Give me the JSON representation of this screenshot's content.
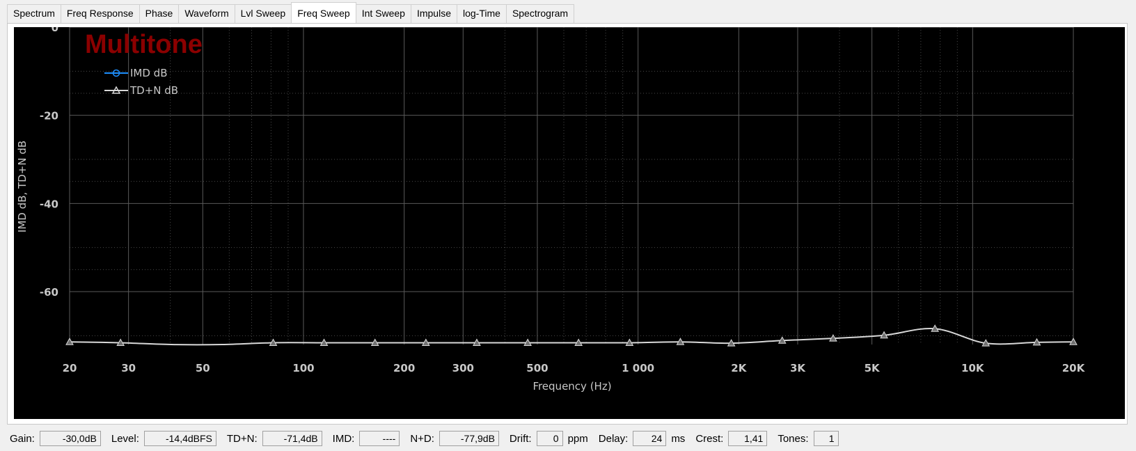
{
  "tabs": [
    {
      "label": "Spectrum",
      "active": false
    },
    {
      "label": "Freq Response",
      "active": false
    },
    {
      "label": "Phase",
      "active": false
    },
    {
      "label": "Waveform",
      "active": false
    },
    {
      "label": "Lvl Sweep",
      "active": false
    },
    {
      "label": "Freq Sweep",
      "active": true
    },
    {
      "label": "Int Sweep",
      "active": false
    },
    {
      "label": "Impulse",
      "active": false
    },
    {
      "label": "log-Time",
      "active": false
    },
    {
      "label": "Spectrogram",
      "active": false
    }
  ],
  "chart_data": {
    "type": "line",
    "watermark": "Multitone",
    "xlabel": "Frequency (Hz)",
    "ylabel": "IMD dB, TD+N dB",
    "xscale": "log",
    "xlim": [
      20,
      20000
    ],
    "ylim": [
      -72,
      0
    ],
    "x_ticks": [
      {
        "value": 20,
        "label": "20"
      },
      {
        "value": 30,
        "label": "30"
      },
      {
        "value": 50,
        "label": "50"
      },
      {
        "value": 100,
        "label": "100"
      },
      {
        "value": 200,
        "label": "200"
      },
      {
        "value": 300,
        "label": "300"
      },
      {
        "value": 500,
        "label": "500"
      },
      {
        "value": 1000,
        "label": "1 000"
      },
      {
        "value": 2000,
        "label": "2K"
      },
      {
        "value": 3000,
        "label": "3K"
      },
      {
        "value": 5000,
        "label": "5K"
      },
      {
        "value": 10000,
        "label": "10K"
      },
      {
        "value": 20000,
        "label": "20K"
      }
    ],
    "y_ticks": [
      {
        "value": 0,
        "label": "0"
      },
      {
        "value": -20,
        "label": "-20"
      },
      {
        "value": -40,
        "label": "-40"
      },
      {
        "value": -60,
        "label": "-60"
      }
    ],
    "y_minor_ticks": [
      -10,
      -15,
      -30,
      -35,
      -50,
      -55,
      -70
    ],
    "grid": true,
    "legend_position": "top-left",
    "series": [
      {
        "name": "IMD dB",
        "color": "#1e90ff",
        "marker": "circle",
        "x": [],
        "y": []
      },
      {
        "name": "TD+N dB",
        "color": "#d8d8d8",
        "marker": "triangle",
        "x": [
          20,
          28.4,
          40.3,
          57.2,
          81.2,
          115.2,
          163.6,
          232.2,
          329.6,
          468,
          664,
          942.8,
          1338,
          1900,
          2697,
          3829,
          5436,
          7715,
          10950,
          15550,
          20000
        ],
        "y": [
          -71.4,
          -71.6,
          -72.0,
          -72.0,
          -71.6,
          -71.6,
          -71.6,
          -71.6,
          -71.6,
          -71.6,
          -71.6,
          -71.6,
          -71.4,
          -71.7,
          -71.1,
          -70.6,
          -69.9,
          -68.4,
          -71.7,
          -71.5,
          -71.4
        ],
        "marker_x": [
          20,
          28.4,
          81.2,
          115.2,
          163.6,
          232.2,
          329.6,
          468,
          664,
          942.8,
          1338,
          1900,
          2697,
          3829,
          5436,
          7715,
          10950,
          15550,
          20000
        ]
      }
    ]
  },
  "status": [
    {
      "label": "Gain:",
      "value": "-30,0dB",
      "unit": "",
      "width": 88
    },
    {
      "label": "Level:",
      "value": "-14,4dBFS",
      "unit": "",
      "width": 104
    },
    {
      "label": "TD+N:",
      "value": "-71,4dB",
      "unit": "",
      "width": 86
    },
    {
      "label": "IMD:",
      "value": "----",
      "unit": "",
      "width": 58
    },
    {
      "label": "N+D:",
      "value": "-77,9dB",
      "unit": "",
      "width": 86
    },
    {
      "label": "Drift:",
      "value": "0",
      "unit": "ppm",
      "width": 38
    },
    {
      "label": "Delay:",
      "value": "24",
      "unit": "ms",
      "width": 48
    },
    {
      "label": "Crest:",
      "value": "1,41",
      "unit": "",
      "width": 56
    },
    {
      "label": "Tones:",
      "value": "1",
      "unit": "",
      "width": 36
    }
  ]
}
